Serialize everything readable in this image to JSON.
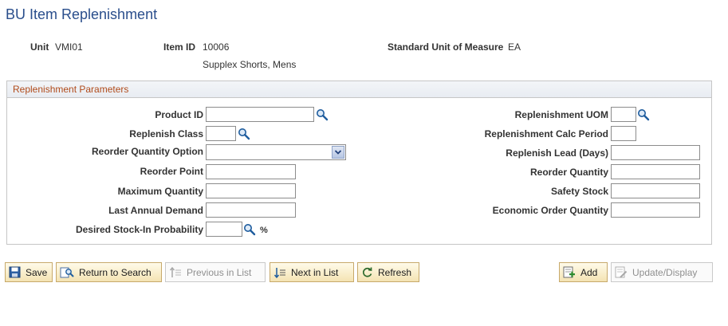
{
  "page": {
    "title": "BU Item Replenishment"
  },
  "header": {
    "unit_label": "Unit",
    "unit_value": "VMI01",
    "item_label": "Item ID",
    "item_value": "10006",
    "item_desc": "Supplex Shorts, Mens",
    "uom_label": "Standard Unit of Measure",
    "uom_value": "EA"
  },
  "params": {
    "title": "Replenishment Parameters",
    "product_id": {
      "label": "Product ID",
      "value": ""
    },
    "replenish_class": {
      "label": "Replenish Class",
      "value": ""
    },
    "reorder_qty_option": {
      "label": "Reorder Quantity Option",
      "value": ""
    },
    "reorder_point": {
      "label": "Reorder Point",
      "value": ""
    },
    "maximum_qty": {
      "label": "Maximum Quantity",
      "value": ""
    },
    "last_annual_demand": {
      "label": "Last Annual Demand",
      "value": ""
    },
    "desired_stock_prob": {
      "label": "Desired Stock-In Probability",
      "value": "",
      "suffix": "%"
    },
    "replenishment_uom": {
      "label": "Replenishment UOM",
      "value": ""
    },
    "calc_period": {
      "label": "Replenishment Calc Period",
      "value": ""
    },
    "lead_days": {
      "label": "Replenish Lead (Days)",
      "value": ""
    },
    "reorder_qty": {
      "label": "Reorder Quantity",
      "value": ""
    },
    "safety_stock": {
      "label": "Safety Stock",
      "value": ""
    },
    "eoq": {
      "label": "Economic Order Quantity",
      "value": ""
    }
  },
  "toolbar": {
    "save": "Save",
    "return_to_search": "Return to Search",
    "previous_in_list": "Previous in List",
    "next_in_list": "Next in List",
    "refresh": "Refresh",
    "add": "Add",
    "update_display": "Update/Display"
  },
  "icons": {
    "lookup": "magnifier-icon",
    "dropdown": "chevron-down-icon",
    "save": "save-icon",
    "return": "return-to-search-icon",
    "previous": "previous-in-list-icon",
    "next": "next-in-list-icon",
    "refresh": "refresh-icon",
    "add": "add-icon",
    "update": "update-display-icon"
  },
  "colors": {
    "title": "#2a4e8c",
    "group_title": "#b04b1b",
    "button_border": "#c7a96b"
  }
}
